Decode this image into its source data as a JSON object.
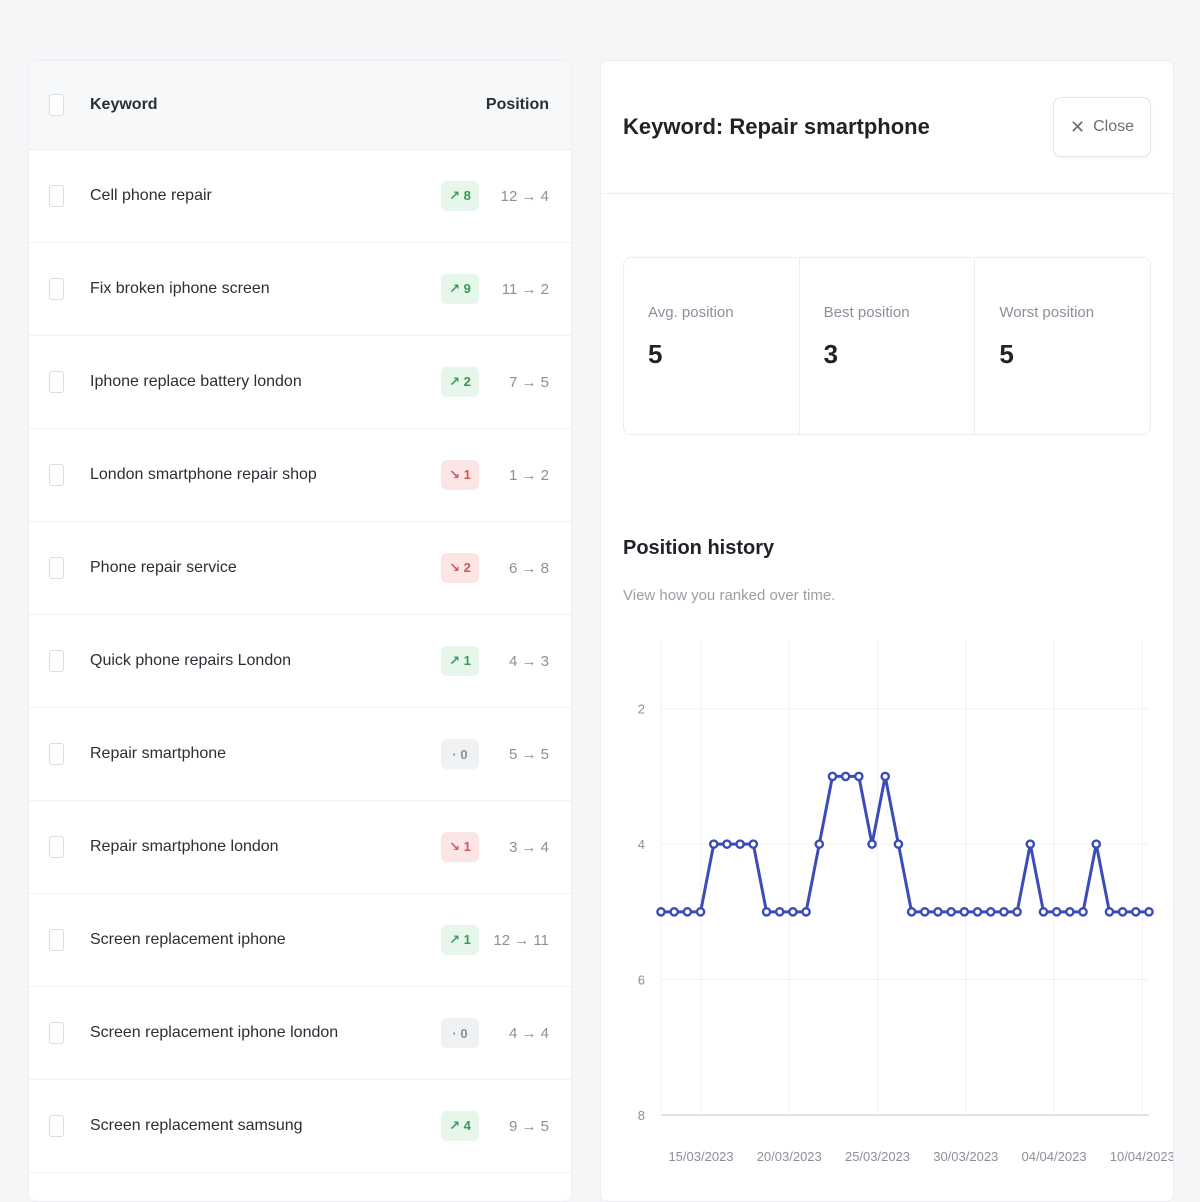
{
  "keyword_table": {
    "header_keyword": "Keyword",
    "header_position": "Position",
    "rows": [
      {
        "keyword": "Cell phone repair",
        "change": "↗ 8",
        "trend": "up",
        "positions": "12 → 4"
      },
      {
        "keyword": "Fix broken iphone screen",
        "change": "↗ 9",
        "trend": "up",
        "positions": "11 → 2"
      },
      {
        "keyword": "Iphone replace battery london",
        "change": "↗ 2",
        "trend": "up",
        "positions": "7 → 5"
      },
      {
        "keyword": "London smartphone repair shop",
        "change": "↘ 1",
        "trend": "down",
        "positions": "1 → 2"
      },
      {
        "keyword": "Phone repair service",
        "change": "↘ 2",
        "trend": "down",
        "positions": "6 → 8"
      },
      {
        "keyword": "Quick phone repairs London",
        "change": "↗ 1",
        "trend": "up",
        "positions": "4 → 3"
      },
      {
        "keyword": "Repair smartphone",
        "change": "· 0",
        "trend": "same",
        "positions": "5 → 5"
      },
      {
        "keyword": "Repair smartphone london",
        "change": "↘ 1",
        "trend": "down",
        "positions": "3 → 4"
      },
      {
        "keyword": "Screen replacement iphone",
        "change": "↗ 1",
        "trend": "up",
        "positions": "12 → 11"
      },
      {
        "keyword": "Screen replacement iphone london",
        "change": "· 0",
        "trend": "same",
        "positions": "4 → 4"
      },
      {
        "keyword": "Screen replacement samsung",
        "change": "↗ 4",
        "trend": "up",
        "positions": "9 → 5"
      }
    ]
  },
  "detail": {
    "title": "Keyword: Repair smartphone",
    "close_label": "Close",
    "close_icon": "close-icon",
    "stats": [
      {
        "label": "Avg. position",
        "value": "5"
      },
      {
        "label": "Best position",
        "value": "3"
      },
      {
        "label": "Worst position",
        "value": "5"
      }
    ],
    "chart_title": "Position history",
    "chart_subtitle": "View how you ranked over time."
  },
  "colors": {
    "line": "#3b4bb8",
    "up_badge_bg": "#e6f6ea",
    "down_badge_bg": "#fbe5e5"
  },
  "chart_data": {
    "type": "line",
    "title": "Position history",
    "subtitle": "View how you ranked over time.",
    "xlabel": "",
    "ylabel": "",
    "y_reversed": true,
    "ylim": [
      1,
      8
    ],
    "yticks": [
      2,
      4,
      6,
      8
    ],
    "xtick_labels": [
      "15/03/2023",
      "20/03/2023",
      "25/03/2023",
      "30/03/2023",
      "04/04/2023",
      "10/04/2023"
    ],
    "grid": true,
    "series": [
      {
        "values": [
          5,
          5,
          5,
          5,
          4,
          4,
          4,
          4,
          5,
          5,
          5,
          5,
          4,
          3,
          3,
          3,
          4,
          3,
          4,
          5,
          5,
          5,
          5,
          5,
          5,
          5,
          5,
          5,
          4,
          5,
          5,
          5,
          5,
          4,
          5,
          5,
          5,
          5
        ]
      }
    ]
  }
}
